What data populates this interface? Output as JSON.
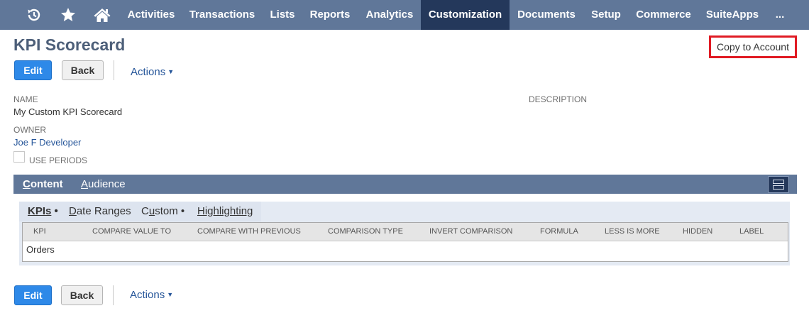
{
  "nav": {
    "icons": [
      "history-icon",
      "star-icon",
      "home-icon"
    ],
    "items": [
      "Activities",
      "Transactions",
      "Lists",
      "Reports",
      "Analytics",
      "Customization",
      "Documents",
      "Setup",
      "Commerce",
      "SuiteApps",
      "..."
    ],
    "active": "Customization",
    "colors": {
      "bar": "#607799",
      "active": "#24385b"
    }
  },
  "page": {
    "title": "KPI Scorecard",
    "copy_to_account": "Copy to Account"
  },
  "toolbar": {
    "edit": "Edit",
    "back": "Back",
    "actions": "Actions"
  },
  "fields": {
    "name_label": "NAME",
    "name_value": "My Custom KPI Scorecard",
    "description_label": "DESCRIPTION",
    "owner_label": "OWNER",
    "owner_value": "Joe F Developer",
    "use_periods_label": "USE PERIODS",
    "use_periods_checked": false
  },
  "tabs": {
    "items": [
      {
        "first": "C",
        "rest": "ontent"
      },
      {
        "first": "A",
        "rest": "udience"
      }
    ],
    "active": "Content"
  },
  "subtabs": {
    "kpis": {
      "underlined": "KPIs",
      "suffix": " •"
    },
    "date_ranges": {
      "underlined": "D",
      "rest": "ate Ranges"
    },
    "custom": {
      "lead": "C",
      "underlined": "u",
      "rest": "stom •"
    },
    "highlighting": {
      "underlined": "Highlighting"
    }
  },
  "table": {
    "columns": [
      "KPI",
      "COMPARE VALUE TO",
      "COMPARE WITH PREVIOUS",
      "COMPARISON TYPE",
      "INVERT COMPARISON",
      "FORMULA",
      "LESS IS MORE",
      "HIDDEN",
      "LABEL"
    ],
    "rows": [
      [
        "Orders",
        "",
        "",
        "",
        "",
        "",
        "",
        "",
        ""
      ]
    ]
  },
  "colors": {
    "accent": "#2e89e8",
    "link": "#255599",
    "highlight_box": "#e01b24"
  }
}
